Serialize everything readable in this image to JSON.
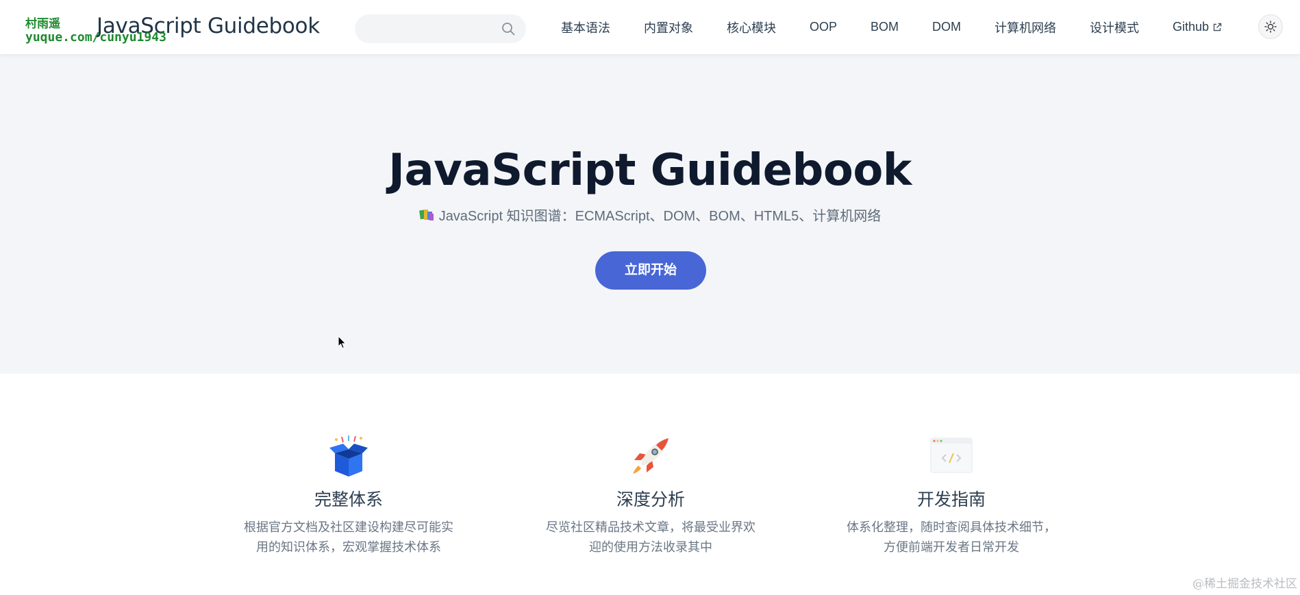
{
  "watermark": {
    "line1": "村雨遥",
    "line2": "yuque.com/cunyu1943",
    "bottom": "@稀土掘金技术社区"
  },
  "navbar": {
    "title": "JavaScript Guidebook",
    "search": {
      "placeholder": "",
      "icon": "search-icon"
    },
    "items": [
      {
        "label": "基本语法"
      },
      {
        "label": "内置对象"
      },
      {
        "label": "核心模块"
      },
      {
        "label": "OOP"
      },
      {
        "label": "BOM"
      },
      {
        "label": "DOM"
      },
      {
        "label": "计算机网络"
      },
      {
        "label": "设计模式"
      },
      {
        "label": "Github",
        "icon": "external-link-icon"
      }
    ],
    "theme_toggle_icon": "sun-icon"
  },
  "hero": {
    "title": "JavaScript Guidebook",
    "tagline": "JavaScript 知识图谱：ECMAScript、DOM、BOM、HTML5、计算机网络",
    "tagline_icon": "books-icon",
    "cta": "立即开始"
  },
  "features": [
    {
      "icon": "open-box-icon",
      "title": "完整体系",
      "desc": "根据官方文档及社区建设构建尽可能实用的知识体系，宏观掌握技术体系"
    },
    {
      "icon": "rocket-icon",
      "title": "深度分析",
      "desc": "尽览社区精品技术文章，将最受业界欢迎的使用方法收录其中"
    },
    {
      "icon": "code-window-icon",
      "title": "开发指南",
      "desc": "体系化整理，随时查阅具体技术细节，方便前端开发者日常开发"
    }
  ],
  "colors": {
    "accent": "#4866d6",
    "hero_bg": "#f3f5f8",
    "title": "#0f1a2e"
  }
}
